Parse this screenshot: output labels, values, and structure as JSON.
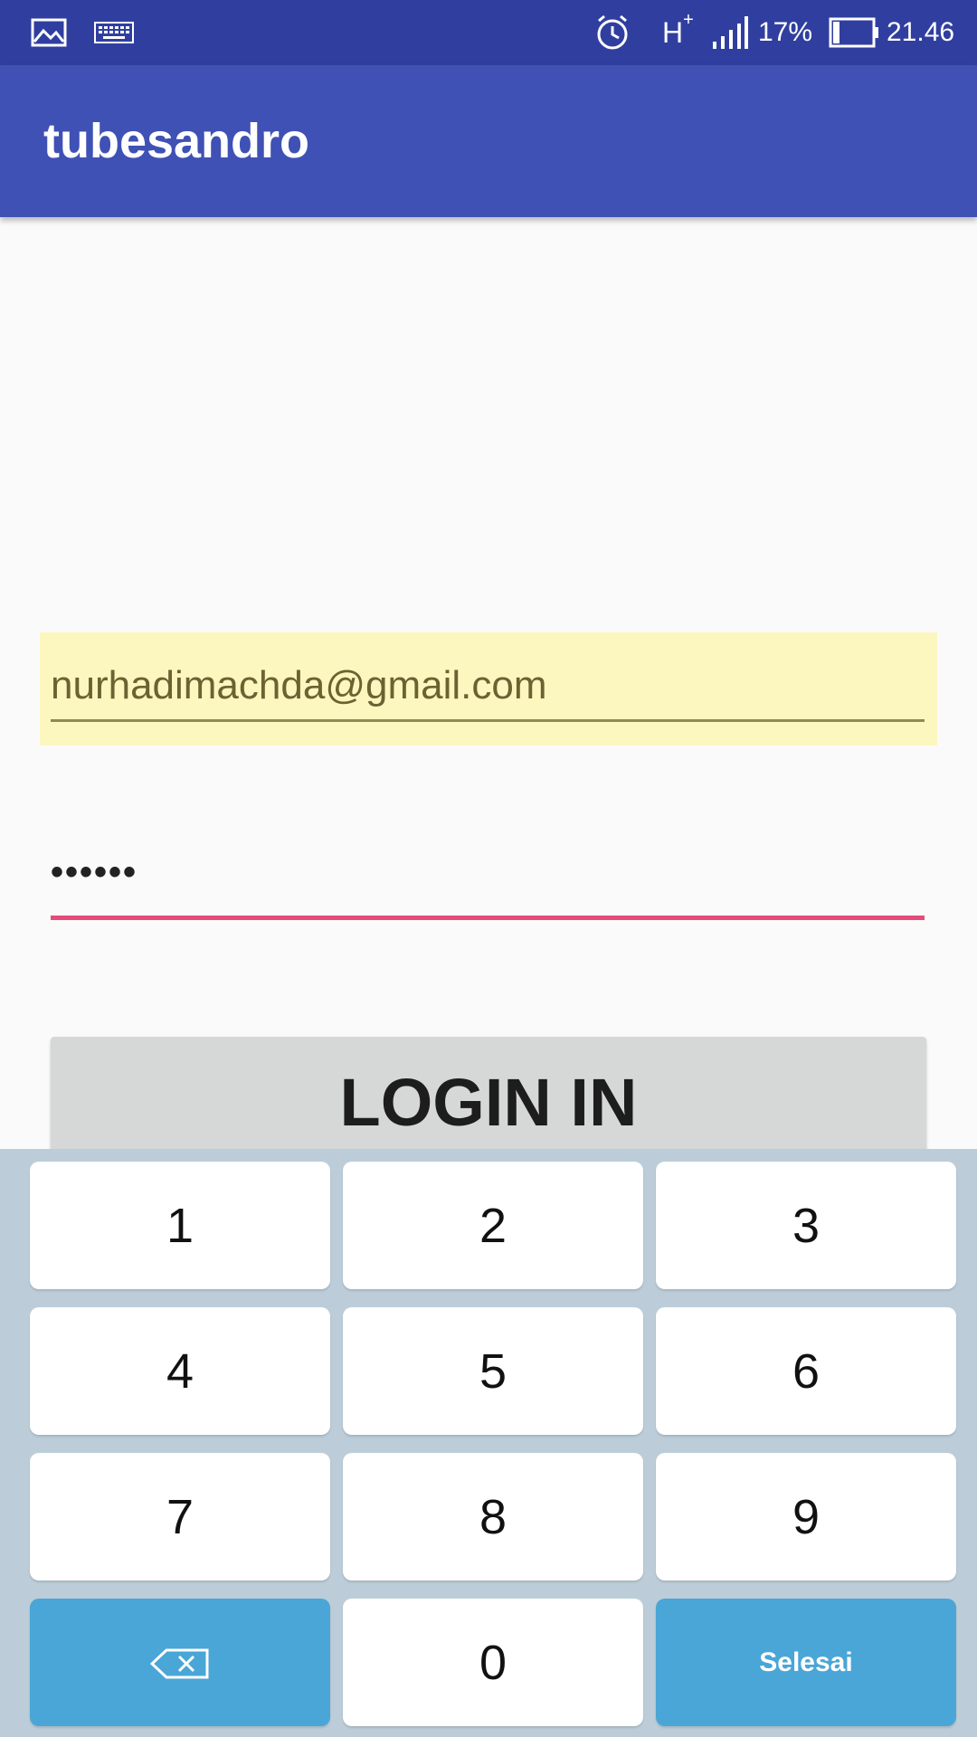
{
  "status_bar": {
    "battery_percent": "17%",
    "time": "21.46",
    "network_type": "H",
    "network_plus": "+",
    "icons": [
      "image-icon",
      "keyboard-icon",
      "alarm-icon",
      "signal-icon",
      "battery-icon"
    ]
  },
  "app_bar": {
    "title": "tubesandro"
  },
  "form": {
    "email_value": "nurhadimachda@gmail.com",
    "password_masked": "••••••",
    "login_label": "LOGIN IN"
  },
  "keyboard": {
    "keys": [
      "1",
      "2",
      "3",
      "4",
      "5",
      "6",
      "7",
      "8",
      "9",
      "0"
    ],
    "done_label": "Selesai",
    "backspace_icon": "backspace-icon"
  },
  "colors": {
    "status_bar": "#303f9f",
    "app_bar": "#3f51b5",
    "accent": "#e64a7a",
    "autofill_bg": "#fbf7bf",
    "keyboard_bg": "#bccdd9",
    "key_action": "#4aa6d7"
  }
}
